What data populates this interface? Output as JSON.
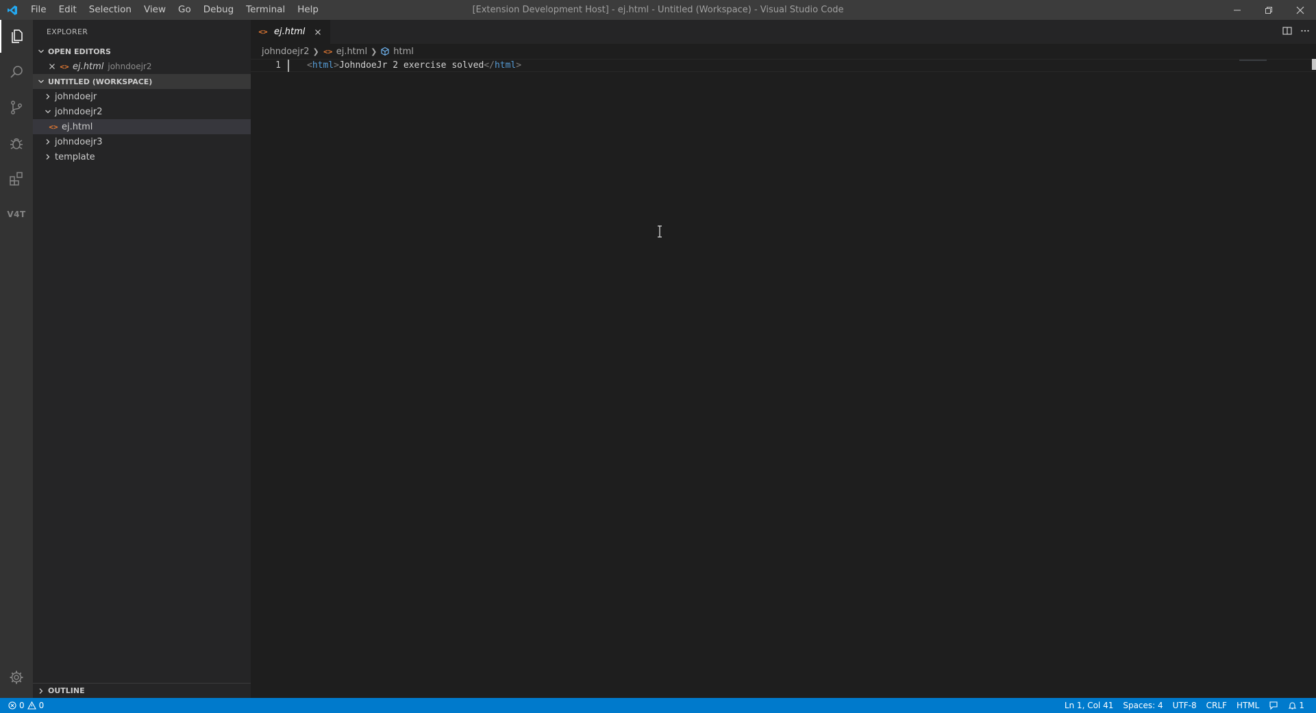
{
  "titlebar": {
    "title": "[Extension Development Host] - ej.html - Untitled (Workspace) - Visual Studio Code",
    "menu": [
      "File",
      "Edit",
      "Selection",
      "View",
      "Go",
      "Debug",
      "Terminal",
      "Help"
    ]
  },
  "activitybar": {
    "extension_label": "V4T"
  },
  "sidebar": {
    "title": "EXPLORER",
    "open_editors": {
      "label": "OPEN EDITORS",
      "file": "ej.html",
      "folder": "johndoejr2"
    },
    "workspace": {
      "label": "UNTITLED (WORKSPACE)",
      "items": [
        {
          "label": "johndoejr",
          "type": "folder",
          "expanded": false
        },
        {
          "label": "johndoejr2",
          "type": "folder",
          "expanded": true
        },
        {
          "label": "ej.html",
          "type": "file",
          "selected": true
        },
        {
          "label": "johndoejr3",
          "type": "folder",
          "expanded": false
        },
        {
          "label": "template",
          "type": "folder",
          "expanded": false
        }
      ]
    },
    "outline_label": "OUTLINE"
  },
  "editor": {
    "tab_label": "ej.html",
    "breadcrumb": [
      "johndoejr2",
      "ej.html",
      "html"
    ],
    "line_number": "1",
    "code": {
      "open_lt": "<",
      "open_tag": "html",
      "open_gt": ">",
      "text": "JohndoeJr 2 exercise solved",
      "close_lt": "</",
      "close_tag": "html",
      "close_gt": ">"
    }
  },
  "statusbar": {
    "errors": "0",
    "warnings": "0",
    "position": "Ln 1, Col 41",
    "spaces": "Spaces: 4",
    "encoding": "UTF-8",
    "eol": "CRLF",
    "language": "HTML",
    "notifications": "1"
  },
  "colors": {
    "accent": "#007acc",
    "html_icon": "#e37933",
    "tag": "#569cd6"
  }
}
